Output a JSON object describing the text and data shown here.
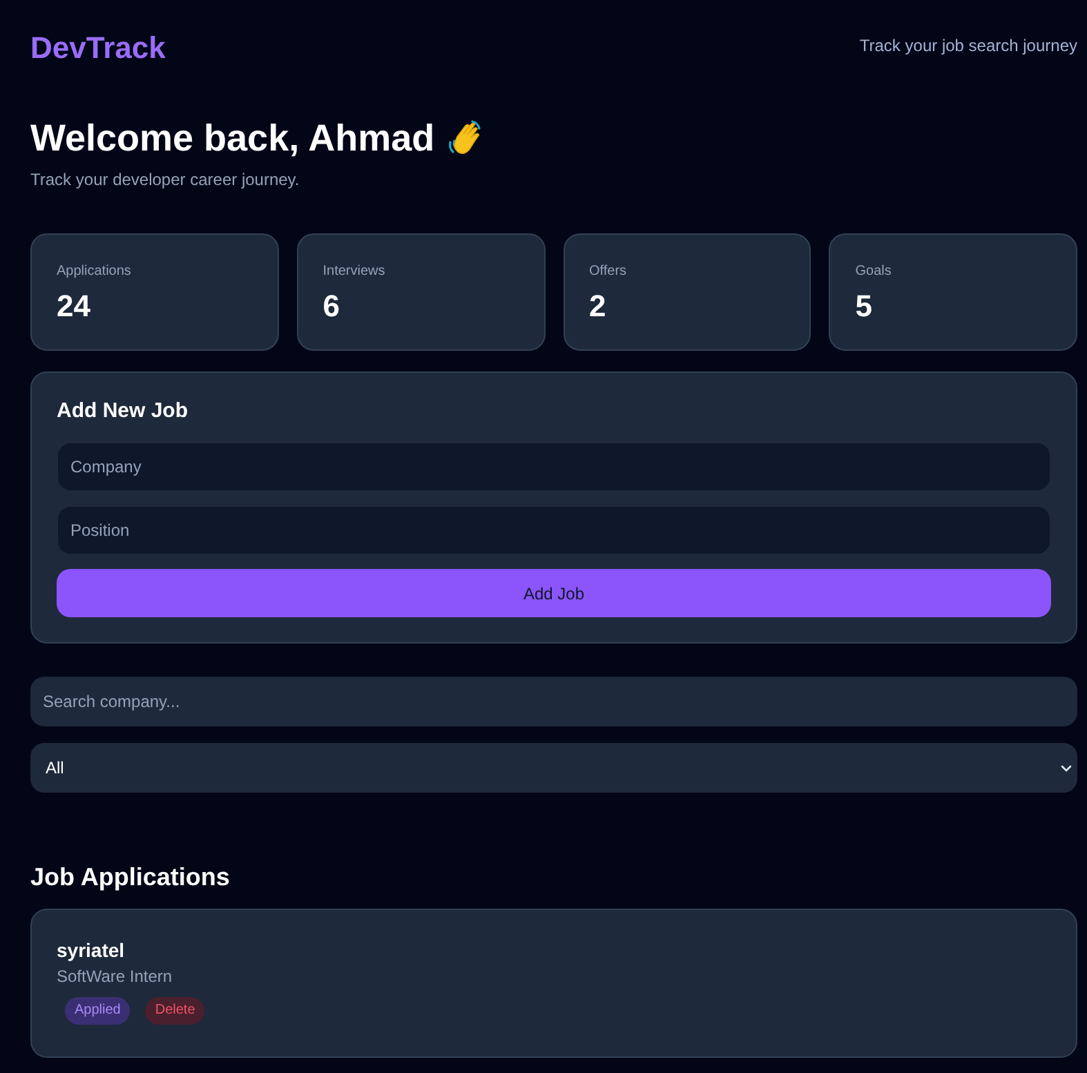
{
  "header": {
    "logo": "DevTrack",
    "tagline": "Track your job search journey"
  },
  "welcome": {
    "title": "Welcome back, Ahmad",
    "subtitle": "Track your developer career journey."
  },
  "stats": [
    {
      "label": "Applications",
      "value": "24"
    },
    {
      "label": "Interviews",
      "value": "6"
    },
    {
      "label": "Offers",
      "value": "2"
    },
    {
      "label": "Goals",
      "value": "5"
    }
  ],
  "add_job": {
    "title": "Add New Job",
    "fields": [
      {
        "placeholder": "Company"
      },
      {
        "placeholder": "Position"
      }
    ],
    "button": "Add Job"
  },
  "search": {
    "placeholder": "Search company..."
  },
  "filter": {
    "value": "All"
  },
  "job_list": {
    "title": "Job Applications",
    "jobs": [
      {
        "company": "syriatel",
        "position": "SoftWare Intern",
        "status": {
          "label": "Applied",
          "kind": "applied"
        },
        "delete_label": "Delete"
      }
    ]
  }
}
